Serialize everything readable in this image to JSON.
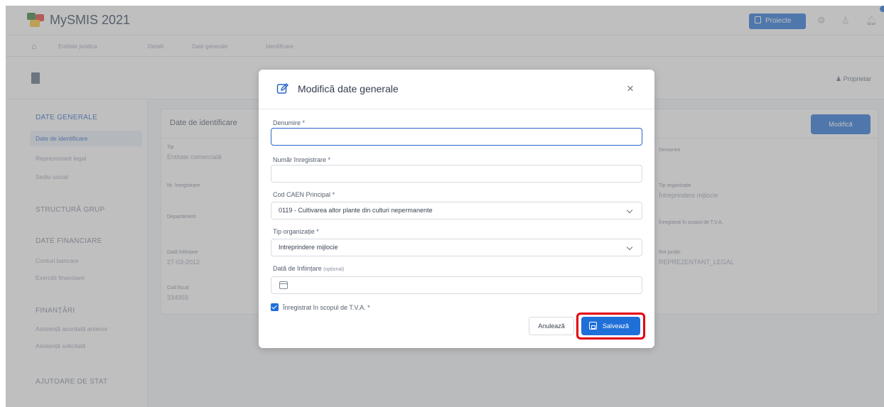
{
  "app": {
    "title": "MySMIS 2021",
    "projects_button": "Proiecte"
  },
  "breadcrumb": [
    "Entitate juridica",
    "Detalii",
    "Date generale",
    "Identificare"
  ],
  "header": {
    "owner_label": "Proprietar"
  },
  "sidebar": {
    "sections": [
      {
        "label": "DATE GENERALE",
        "items": [
          "Date de identificare",
          "Reprezentant legal",
          "Sediu social"
        ]
      },
      {
        "label": "STRUCTURĂ GRUP",
        "items": []
      },
      {
        "label": "DATE FINANCIARE",
        "items": [
          "Conturi bancare",
          "Exerciții financiare"
        ]
      },
      {
        "label": "FINANȚĂRI",
        "items": [
          "Asistență acordată anterior",
          "Asistență solicitată"
        ]
      },
      {
        "label": "AJUTOARE DE STAT",
        "items": []
      }
    ]
  },
  "content": {
    "title": "Date de identificare",
    "modify_button": "Modifică",
    "fields": {
      "tip_label": "Tip",
      "tip_value": "Entitate comercială",
      "nr_label": "Nr. înregistrare",
      "dept_label": "Departament",
      "infiintare_label": "Dată înființare",
      "infiintare_value": "27-03-2012",
      "cod_label": "Cod fiscal",
      "cod_value": "334959",
      "denumire_label": "Denumire",
      "organizatie_label": "Tip organizație",
      "organizatie_value": "Întreprindere mijlocie",
      "tva_label": "Înregistrat în scopul de T.V.A.",
      "persoana_label": "Rol juridic",
      "persoana_value": "REPREZENTANT_LEGAL"
    }
  },
  "modal": {
    "title": "Modifică date generale",
    "denumire_label": "Denumire *",
    "denumire_value": "",
    "numar_label": "Număr înregistrare *",
    "numar_value": "",
    "caen_label": "Cod CAEN Principal *",
    "caen_value": "0119 - Cultivarea altor plante din culturi nepermanente",
    "tip_org_label": "Tip organizație *",
    "tip_org_value": "Intreprindere mijlocie",
    "data_label": "Dată de înființare",
    "data_optional": "(opțional)",
    "data_value": "",
    "tva_label": "Înregistrat în scopul de T.V.A. *",
    "tva_checked": true,
    "cancel_label": "Anulează",
    "save_label": "Salvează"
  }
}
